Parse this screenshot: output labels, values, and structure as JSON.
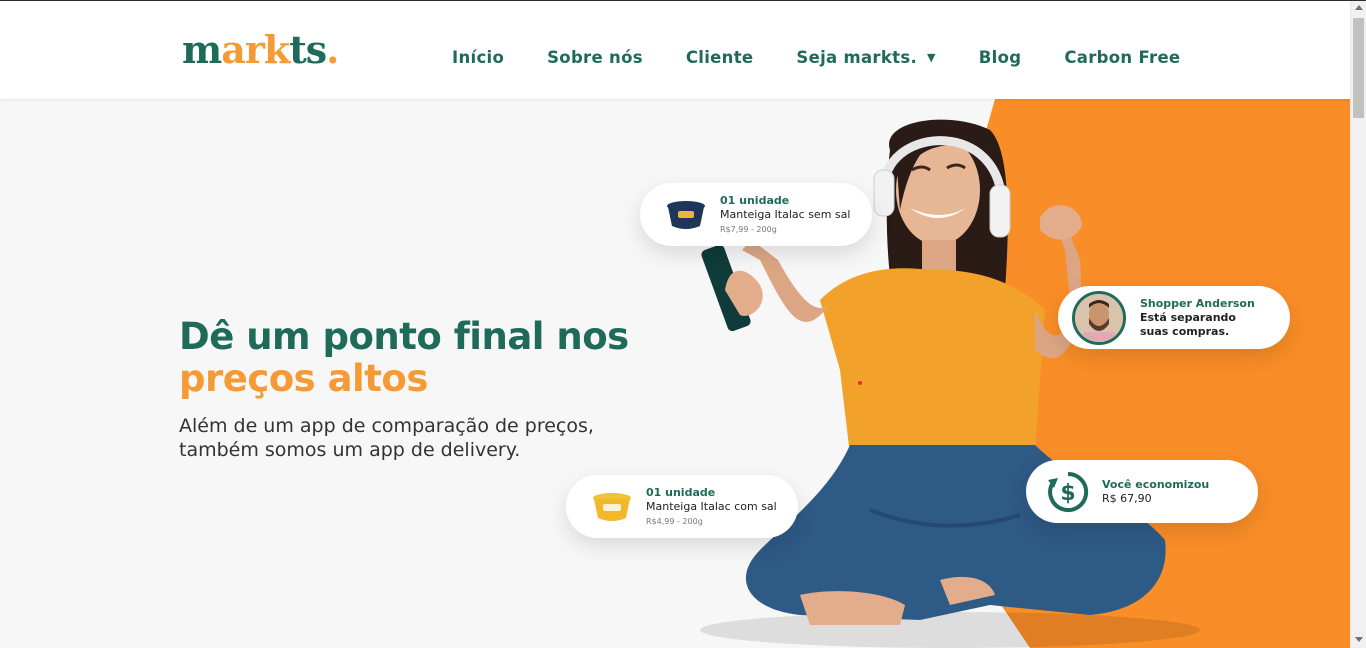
{
  "brand": {
    "logo_part1": "m",
    "logo_part2": "ark",
    "logo_part3": "ts",
    "logo_dot": "."
  },
  "nav": {
    "items": [
      {
        "label": "Início"
      },
      {
        "label": "Sobre nós"
      },
      {
        "label": "Cliente"
      },
      {
        "label": "Seja markts.",
        "has_dropdown": true
      },
      {
        "label": "Blog"
      },
      {
        "label": "Carbon Free"
      }
    ]
  },
  "hero": {
    "headline_line1": "Dê um ponto final nos",
    "headline_line2": "preços altos",
    "subtext": "Além de um app de comparação de preços, também somos um app de delivery."
  },
  "cards": {
    "product1": {
      "qty": "01 unidade",
      "name": "Manteiga Italac sem sal",
      "price": "R$7,99 - 200g"
    },
    "product2": {
      "qty": "01 unidade",
      "name": "Manteiga Italac com sal",
      "price": "R$4,99 - 200g"
    },
    "shopper": {
      "title": "Shopper Anderson",
      "line1": "Está separando",
      "line2": "suas compras."
    },
    "savings": {
      "title": "Você economizou",
      "value": "R$ 67,90"
    }
  },
  "colors": {
    "primary": "#1e6b5a",
    "accent": "#f59b35",
    "hero_orange": "#f98d27"
  }
}
